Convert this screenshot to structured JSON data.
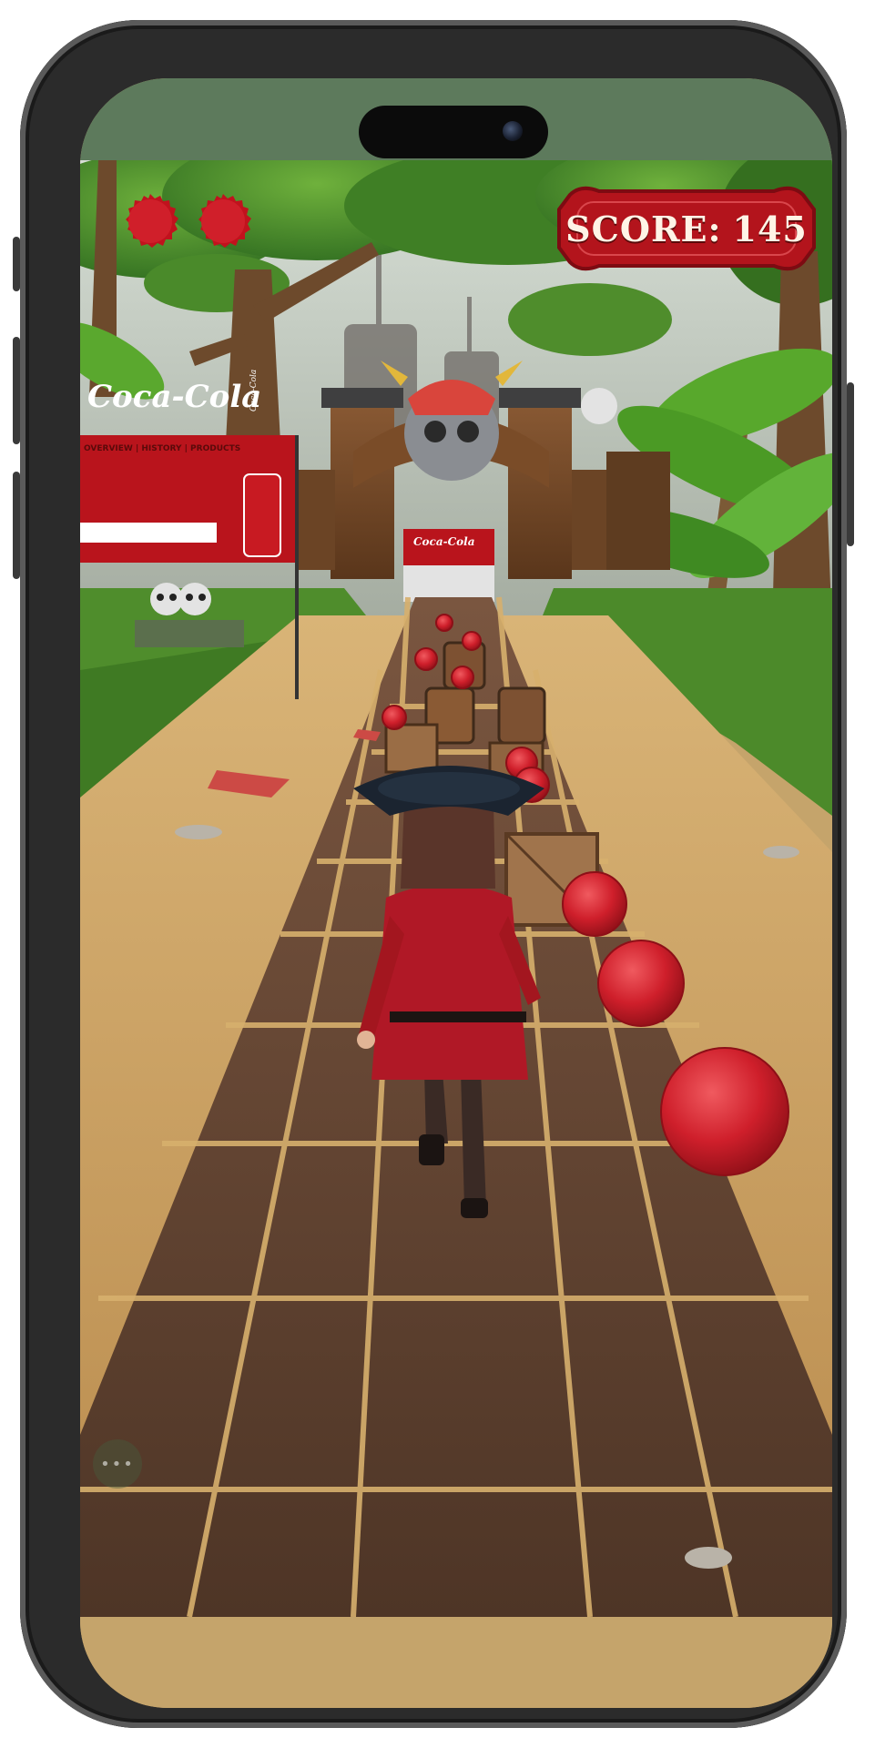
{
  "hud": {
    "lives_remaining": 2,
    "score_label": "SCORE:",
    "score_value": "145"
  },
  "billboard": {
    "brand": "Coca-Cola",
    "nav": "OVERVIEW | HISTORY | PRODUCTS",
    "can_brand": "Coca-Cola",
    "gate_brand": "Coca-Cola"
  },
  "colors": {
    "cap_red": "#cf1f2b",
    "score_plate": "#b3141c",
    "path_stone": "#5a3d2c",
    "sand": "#c99d5d",
    "grass": "#4f8d2c",
    "bezel": "#2b2b2b"
  },
  "icons": {
    "life": "bottle-cap-icon",
    "pause": "more-dots-icon"
  }
}
